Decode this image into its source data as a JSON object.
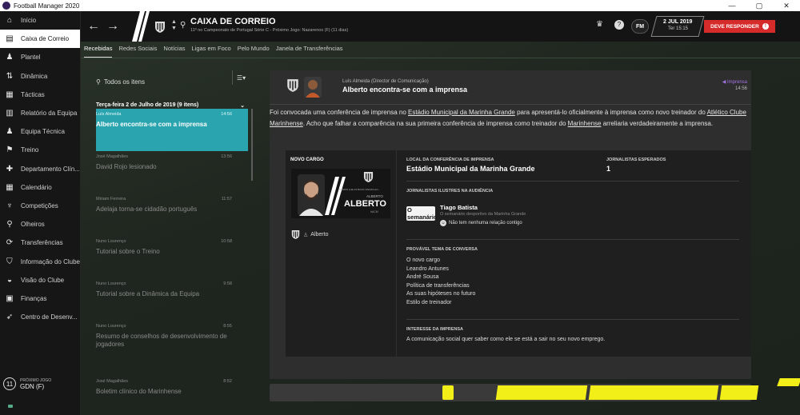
{
  "window": {
    "title": "Football Manager 2020",
    "controls": [
      "—",
      "▢",
      "✕"
    ]
  },
  "sidebar": {
    "items": [
      {
        "label": "Início",
        "icon": "home-icon",
        "glyph": "⌂"
      },
      {
        "label": "Caixa de Correio",
        "icon": "mailbox-icon",
        "glyph": "▤",
        "active": true
      },
      {
        "label": "Plantel",
        "icon": "squad-icon",
        "glyph": "♟"
      },
      {
        "label": "Dinâmica",
        "icon": "dynamics-icon",
        "glyph": "⇅"
      },
      {
        "label": "Tácticas",
        "icon": "tactics-icon",
        "glyph": "▦"
      },
      {
        "label": "Relatório da Equipa",
        "icon": "report-icon",
        "glyph": "▥"
      },
      {
        "label": "Equipa Técnica",
        "icon": "staff-icon",
        "glyph": "♟"
      },
      {
        "label": "Treino",
        "icon": "training-icon",
        "glyph": "⚑"
      },
      {
        "label": "Departamento Clín...",
        "icon": "medical-icon",
        "glyph": "✚"
      },
      {
        "label": "Calendário",
        "icon": "calendar-icon",
        "glyph": "▦"
      },
      {
        "label": "Competições",
        "icon": "trophy-icon",
        "glyph": "♆"
      },
      {
        "label": "Olheiros",
        "icon": "scouting-icon",
        "glyph": "⚲"
      },
      {
        "label": "Transferências",
        "icon": "transfers-icon",
        "glyph": "⟳"
      },
      {
        "label": "Informação do Clube",
        "icon": "club-info-icon",
        "glyph": "⛉"
      },
      {
        "label": "Visão do Clube",
        "icon": "club-vision-icon",
        "glyph": "◒"
      },
      {
        "label": "Finanças",
        "icon": "finances-icon",
        "glyph": "▣"
      },
      {
        "label": "Centro de Desenv...",
        "icon": "development-icon",
        "glyph": "➶"
      }
    ],
    "next_match": {
      "label": "PRÓXIMO JOGO",
      "value": "GDN (F)",
      "number": "11"
    }
  },
  "header": {
    "title": "CAIXA DE CORREIO",
    "subtitle": "11º no Campeonato de Portugal Série C - Próximo Jogo: Nazarenos (F) (11 dias)",
    "fm_label": "FM",
    "date": "2 JUL 2019",
    "time": "Ter 15:15",
    "respond_label": "DEVE RESPONDER",
    "respond_badge": "!"
  },
  "tabs": [
    {
      "label": "Recebidas",
      "active": true
    },
    {
      "label": "Redes Sociais"
    },
    {
      "label": "Notícias"
    },
    {
      "label": "Ligas em Foco"
    },
    {
      "label": "Pelo Mundo"
    },
    {
      "label": "Janela de Transferências"
    }
  ],
  "inbox": {
    "search_label": "Todos os itens",
    "day_header": "Terça-feira 2 de Julho de 2019 (9 itens)",
    "messages": [
      {
        "sender": "Luís Almeida",
        "time": "14:56",
        "subject": "Alberto encontra-se com a imprensa",
        "selected": true
      },
      {
        "sender": "José Magalhães",
        "time": "13:56",
        "subject": "David Rojo lesionado"
      },
      {
        "sender": "Miriam Ferreira",
        "time": "11:57",
        "subject": "Adelaja torna-se cidadão português"
      },
      {
        "sender": "Nuno Lourenço",
        "time": "10:58",
        "subject": "Tutorial sobre o Treino"
      },
      {
        "sender": "Nuno Lourenço",
        "time": "9:58",
        "subject": "Tutorial sobre a Dinâmica da Equipa"
      },
      {
        "sender": "Nuno Lourenço",
        "time": "8:55",
        "subject": "Resumo de conselhos de desenvolvimento de jogadores"
      },
      {
        "sender": "José Magalhães",
        "time": "8:52",
        "subject": "Boletim clínico do Marinhense"
      }
    ]
  },
  "message": {
    "from": "Luís Almeida (Director de Comunicação)",
    "subject": "Alberto encontra-se com a imprensa",
    "tag": "Imprensa",
    "time": "14:56",
    "body": {
      "p1": "Foi convocada uma conferência de imprensa no ",
      "l1": "Estádio Municipal da Marinha Grande",
      "p2": " para apresentá-lo oficialmente à imprensa como novo treinador do ",
      "l2": "Atlético Clube Marinhense",
      "p3": ". Acho que falhar a comparência na sua primeira conferência de imprensa como treinador do ",
      "l3": "Marinhense",
      "p4": " arreliaria verdadeiramente a imprensa."
    },
    "new_job": {
      "header": "NOVO CARGO",
      "card_caption": "DAMOS LHE AS BOAS VINDAS AO...",
      "card_small_name": "ALBERTO",
      "card_name": "ALBERTO",
      "card_club": "#ACM",
      "player_name": "Alberto"
    },
    "venue_label": "LOCAL DA CONFERÊNCIA DE IMPRENSA",
    "venue": "Estádio Municipal da Marinha Grande",
    "journalists_label": "JORNALISTAS ESPERADOS",
    "journalists": "1",
    "notable_label": "JORNALISTAS ILUSTRES NA AUDIÊNCIA",
    "journalist": {
      "outlet_logo": "O semanário",
      "name": "Tiago Batista",
      "desc": "O semanário desportivo da Marinha Grande",
      "relation": "Não tem nenhuma relação contigo"
    },
    "topics_label": "PROVÁVEL TEMA DE CONVERSA",
    "topics": [
      "O novo cargo",
      "Leandro Antunes",
      "André Sousa",
      "Política de transferências",
      "As suas hipóteses no futuro",
      "Estilo de treinador"
    ],
    "interest_label": "INTERESSE DA IMPRENSA",
    "interest": "A comunicação social quer saber como ele se está a sair no seu novo emprego."
  },
  "colors": {
    "accent_teal": "#2aa4ae",
    "respond_red": "#d62b2b",
    "press_purple": "#a373e2",
    "highlight_yellow": "#f2ef18"
  }
}
